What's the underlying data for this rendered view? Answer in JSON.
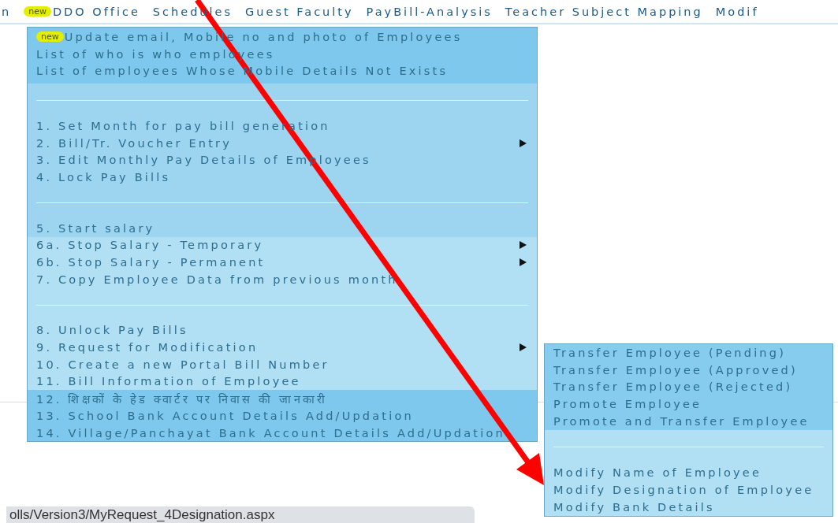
{
  "nav": {
    "items": [
      {
        "label": "n"
      },
      {
        "label": "DDO Office",
        "badge": "new"
      },
      {
        "label": "Schedules"
      },
      {
        "label": "Guest Faculty"
      },
      {
        "label": "PayBill-Analysis"
      },
      {
        "label": "Teacher Subject Mapping"
      },
      {
        "label": "Modif"
      }
    ]
  },
  "menu": {
    "groups": [
      {
        "color": "#7dc8ec",
        "items": [
          {
            "kind": "link",
            "label": "Update email, Mobile no and photo of Employees",
            "badge": "new",
            "submenu": false
          },
          {
            "kind": "link",
            "label": "List of who is who employees",
            "submenu": false
          },
          {
            "kind": "link",
            "label": "List of employees Whose Mobile Details Not Exists",
            "submenu": false
          }
        ]
      },
      {
        "color": "#9dd5f0",
        "items": [
          {
            "kind": "separator"
          },
          {
            "kind": "link",
            "label": "1. Set Month for pay bill generation",
            "submenu": false
          },
          {
            "kind": "link",
            "label": "2. Bill/Tr. Voucher Entry",
            "submenu": true
          },
          {
            "kind": "link",
            "label": "3. Edit Monthly Pay Details of Employees",
            "submenu": false
          },
          {
            "kind": "link",
            "label": "4. Lock Pay Bills",
            "submenu": false
          },
          {
            "kind": "separator"
          },
          {
            "kind": "link",
            "label": "5. Start salary",
            "submenu": false
          }
        ]
      },
      {
        "color": "#b1dff3",
        "items": [
          {
            "kind": "link",
            "label": "6a. Stop Salary - Temporary",
            "submenu": true
          },
          {
            "kind": "link",
            "label": "6b. Stop Salary - Permanent",
            "submenu": true
          },
          {
            "kind": "link",
            "label": "7. Copy Employee Data from previous month",
            "submenu": false
          },
          {
            "kind": "separator"
          },
          {
            "kind": "link",
            "label": "8. Unlock Pay Bills",
            "submenu": false
          },
          {
            "kind": "link",
            "label": "9. Request for Modification",
            "submenu": true
          },
          {
            "kind": "link",
            "label": "10. Create a new Portal Bill Number",
            "submenu": false
          },
          {
            "kind": "link",
            "label": "11. Bill Information of Employee",
            "submenu": false
          }
        ]
      },
      {
        "color": "#7dc8ec",
        "items": [
          {
            "kind": "link",
            "label": "12. शिक्षकों के हेड क्वार्टर पर निवास की जानकारी",
            "submenu": false
          },
          {
            "kind": "link",
            "label": "13. School Bank Account Details Add/Updation",
            "submenu": false
          },
          {
            "kind": "link",
            "label": "14. Village/Panchayat Bank Account Details Add/Updation",
            "submenu": false
          }
        ]
      }
    ]
  },
  "submenu": {
    "groups": [
      {
        "color": "#86ccee",
        "items": [
          {
            "kind": "link",
            "label": "Transfer Employee (Pending)",
            "submenu": false
          },
          {
            "kind": "link",
            "label": "Transfer Employee (Approved)",
            "submenu": false
          },
          {
            "kind": "link",
            "label": "Transfer Employee (Rejected)",
            "submenu": false
          },
          {
            "kind": "link",
            "label": "Promote Employee",
            "submenu": false
          },
          {
            "kind": "link",
            "label": "Promote and Transfer Employee",
            "submenu": false
          }
        ]
      },
      {
        "color": "#b1dff3",
        "items": [
          {
            "kind": "separator"
          },
          {
            "kind": "link",
            "label": "Modify Name of Employee",
            "submenu": false
          },
          {
            "kind": "link",
            "label": "Modify Designation of Employee",
            "submenu": false
          },
          {
            "kind": "link",
            "label": "Modify Bank Details",
            "submenu": false
          }
        ]
      }
    ]
  },
  "status_url": "olls/Version3/MyRequest_4Designation.aspx"
}
